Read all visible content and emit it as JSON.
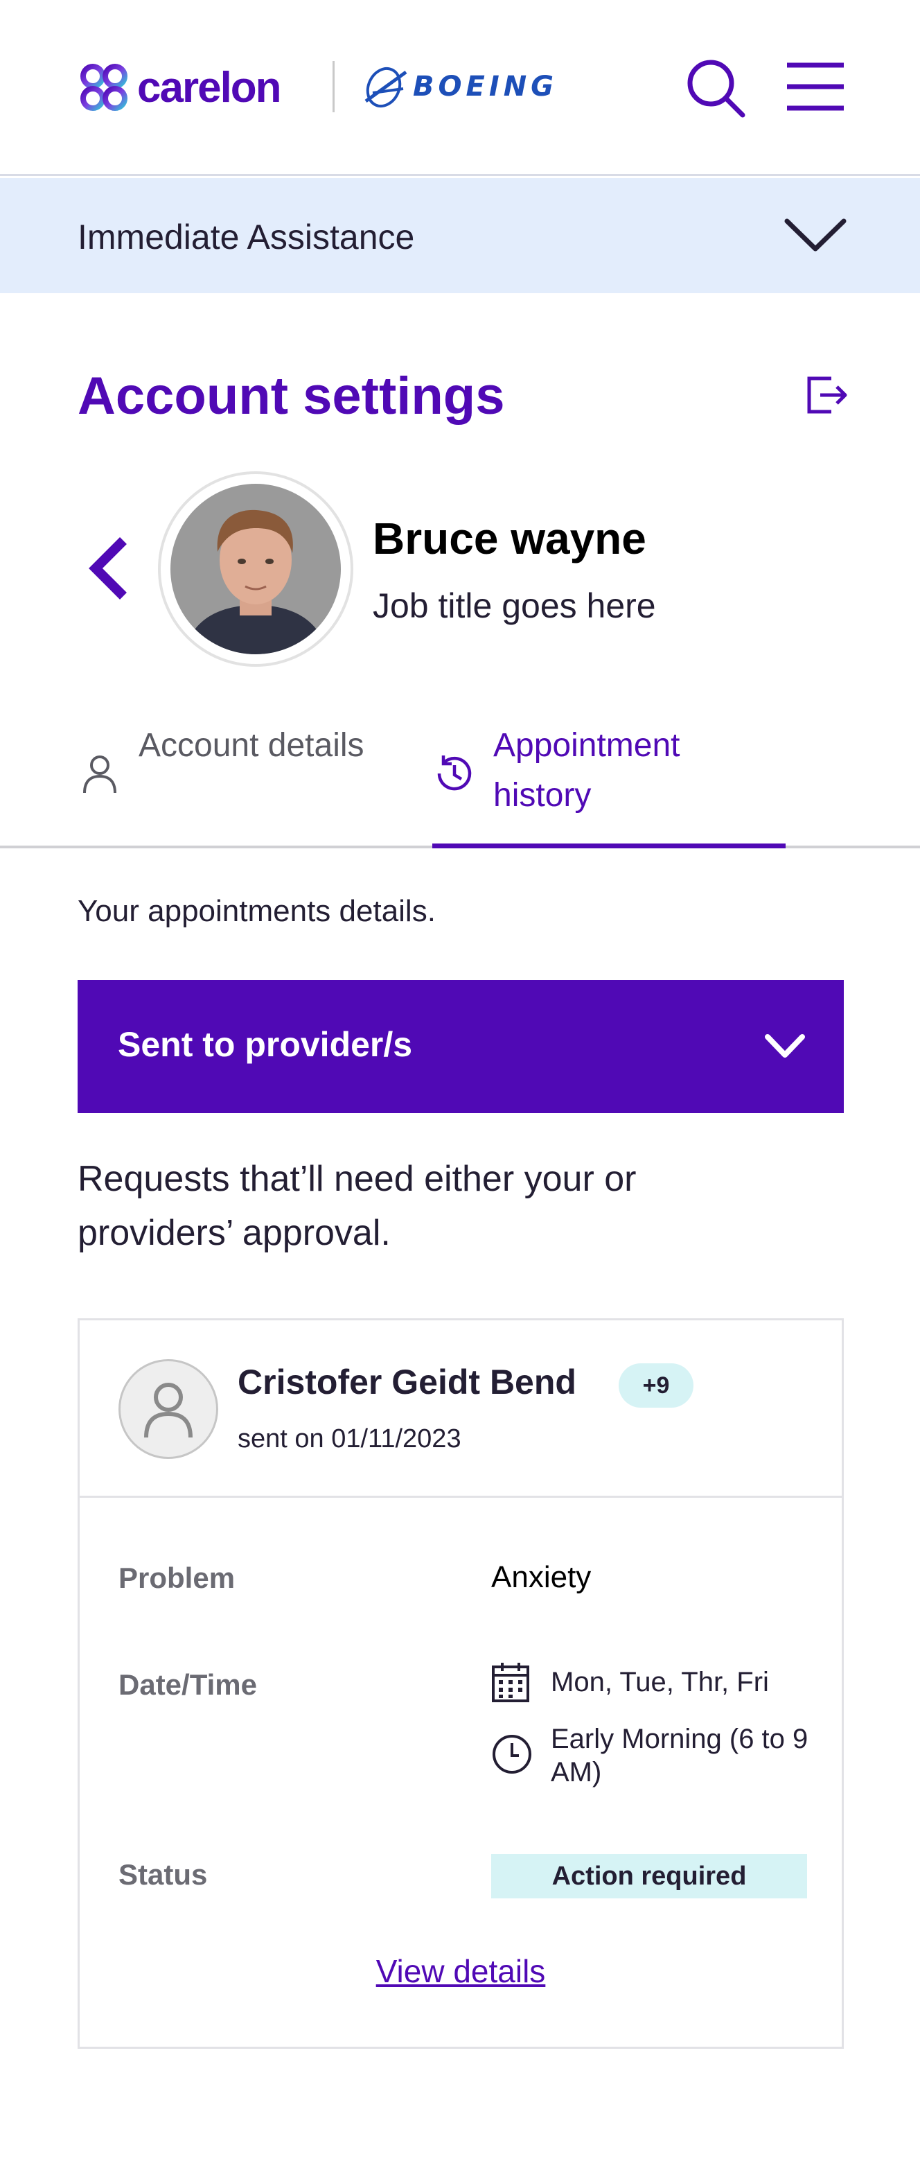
{
  "header": {
    "brand_name": "carelon",
    "partner_name": "BOEING",
    "brand_color": "#5009b5",
    "partner_color": "#1d4fb8",
    "icons": [
      "search-icon",
      "hamburger-menu-icon"
    ]
  },
  "assist": {
    "label": "Immediate Assistance",
    "background": "#e3edfc"
  },
  "page": {
    "title": "Account settings"
  },
  "profile": {
    "name": "Bruce wayne",
    "job_title": "Job title goes here"
  },
  "tabs": [
    {
      "label": "Account details",
      "icon": "user-icon",
      "active": false
    },
    {
      "label": "Appointment history",
      "icon": "history-icon",
      "active": true
    }
  ],
  "intro": "Your appointments details.",
  "dropdown": {
    "label": "Sent to provider/s"
  },
  "request_description": "Requests that’ll need either your or providers’ approval.",
  "card": {
    "provider_name": "Cristofer Geidt Bend",
    "badge": "+9",
    "sent": "sent on 01/11/2023",
    "problem_label": "Problem",
    "problem_value": "Anxiety",
    "datetime_label": "Date/Time",
    "days": "Mon, Tue, Thr, Fri",
    "time": "Early Morning (6 to 9 AM)",
    "status_label": "Status",
    "status_value": "Action required",
    "view_details": "View details"
  }
}
